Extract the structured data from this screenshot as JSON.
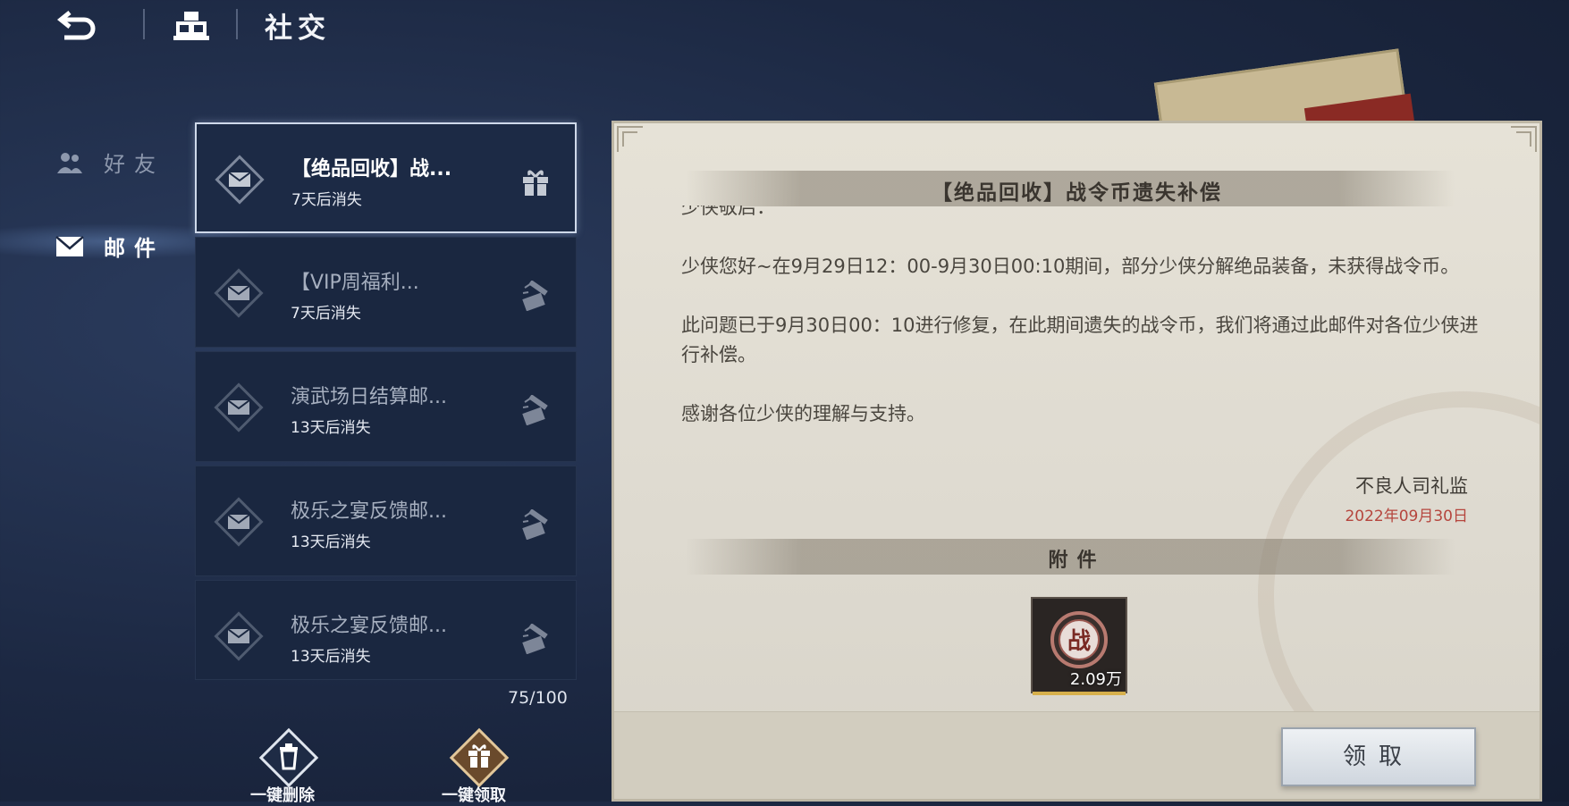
{
  "header": {
    "title": "社交",
    "back_icon": "back-arrow-icon",
    "home_icon": "home-icon"
  },
  "nav": [
    {
      "label": "好友",
      "icon": "friends-icon",
      "active": false
    },
    {
      "label": "邮件",
      "icon": "mail-icon",
      "active": true
    }
  ],
  "mail_list": [
    {
      "title": "【绝品回收】战...",
      "expire": "7天后消失",
      "selected": true,
      "gift_state": "unclaimed"
    },
    {
      "title": "【VIP周福利...",
      "expire": "7天后消失",
      "selected": false,
      "gift_state": "claimed"
    },
    {
      "title": "演武场日结算邮...",
      "expire": "13天后消失",
      "selected": false,
      "gift_state": "claimed"
    },
    {
      "title": "极乐之宴反馈邮...",
      "expire": "13天后消失",
      "selected": false,
      "gift_state": "claimed"
    },
    {
      "title": "极乐之宴反馈邮...",
      "expire": "13天后消失",
      "selected": false,
      "gift_state": "claimed"
    }
  ],
  "mail_count": "75/100",
  "bottom_buttons": {
    "delete_all": "一键删除",
    "claim_all": "一键领取"
  },
  "detail": {
    "subject": "【绝品回收】战令币遗失补偿",
    "greeting_cut": "少侠敬启：",
    "paragraphs": [
      "少侠您好~在9月29日12：00-9月30日00:10期间，部分少侠分解绝品装备，未获得战令币。",
      "此问题已于9月30日00：10进行修复，在此期间遗失的战令币，我们将通过此邮件对各位少侠进行补偿。",
      "感谢各位少侠的理解与支持。"
    ],
    "signature": "不良人司礼监",
    "date": "2022年09月30日",
    "attachment_label": "附件",
    "attachment": {
      "icon_char": "战",
      "quantity": "2.09万"
    },
    "claim_button": "领取"
  },
  "colors": {
    "panel_bg": "#e6e2d7",
    "date_red": "#b5453d",
    "accent_gold": "#d7b04b"
  }
}
